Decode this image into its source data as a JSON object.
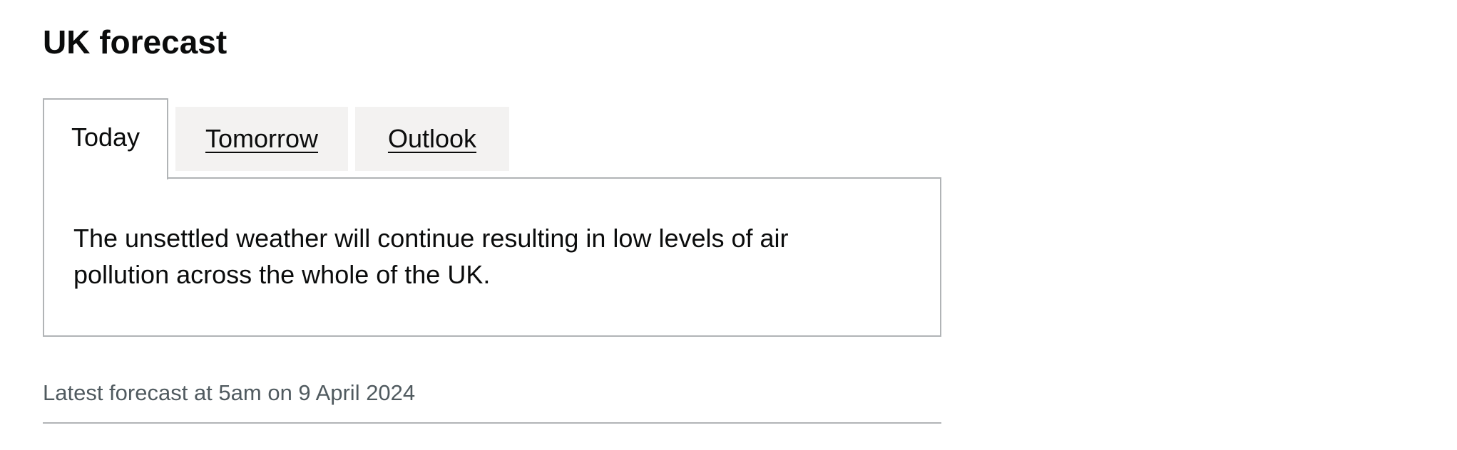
{
  "page": {
    "title": "UK forecast"
  },
  "tabs": [
    {
      "label": "Today",
      "selected": true
    },
    {
      "label": "Tomorrow",
      "selected": false
    },
    {
      "label": "Outlook",
      "selected": false
    }
  ],
  "panel": {
    "text": "The unsettled weather will continue resulting in low levels of air pollution across the whole of the UK."
  },
  "meta": {
    "updated": "Latest forecast at 5am on 9 April 2024"
  },
  "colors": {
    "text": "#0b0c0c",
    "secondary_text": "#505a5f",
    "border": "#b1b4b6",
    "inactive_tab_bg": "#f3f2f1"
  }
}
